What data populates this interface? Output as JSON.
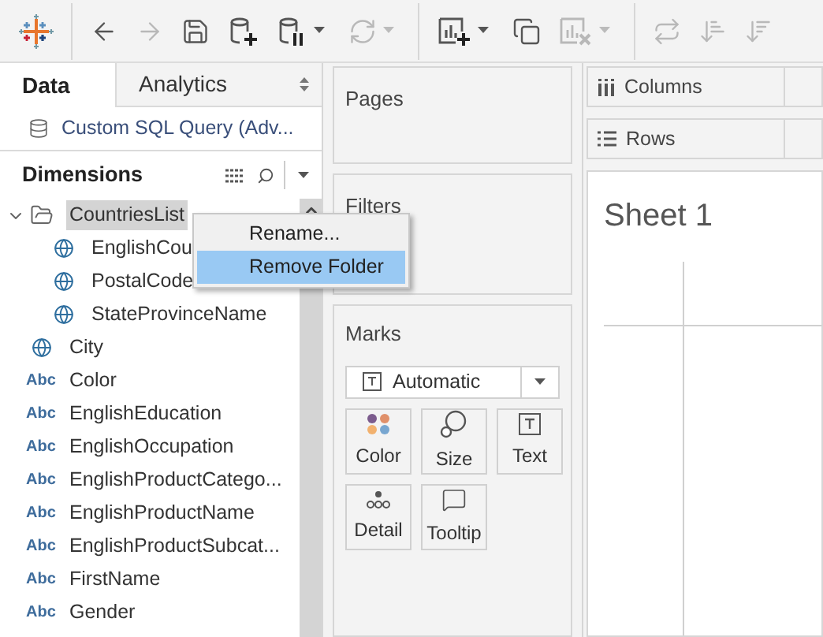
{
  "toolbar": [
    {
      "kind": "logo"
    },
    {
      "kind": "back",
      "disabled": false
    },
    {
      "kind": "forward",
      "disabled": true
    },
    {
      "kind": "save",
      "disabled": false
    },
    {
      "kind": "new-data-source",
      "disabled": false
    },
    {
      "kind": "pause",
      "disabled": false,
      "menu": true
    },
    {
      "kind": "refresh",
      "disabled": true,
      "menu": true
    },
    {
      "kind": "new-sheet",
      "disabled": false,
      "menu": true
    },
    {
      "kind": "duplicate",
      "disabled": false
    },
    {
      "kind": "clear",
      "disabled": true,
      "menu": true
    },
    {
      "kind": "swap",
      "disabled": true
    },
    {
      "kind": "sort-asc",
      "disabled": true
    },
    {
      "kind": "sort-desc",
      "disabled": true
    }
  ],
  "side_tabs": [
    {
      "label": "Data",
      "selected": true
    },
    {
      "label": "Analytics",
      "selected": false
    }
  ],
  "data_source": "Custom SQL Query (Adv...",
  "dimensions": {
    "title": "Dimensions",
    "items": [
      {
        "kind": "folder",
        "label": "CountriesList",
        "selected": true,
        "expanded": true,
        "children": [
          {
            "kind": "geo",
            "label": "EnglishCou"
          },
          {
            "kind": "geo",
            "label": "PostalCode"
          },
          {
            "kind": "geo",
            "label": "StateProvinceName"
          }
        ]
      },
      {
        "kind": "geo",
        "label": "City"
      },
      {
        "kind": "string",
        "type_label": "Abc",
        "label": "Color"
      },
      {
        "kind": "string",
        "type_label": "Abc",
        "label": "EnglishEducation"
      },
      {
        "kind": "string",
        "type_label": "Abc",
        "label": "EnglishOccupation"
      },
      {
        "kind": "string",
        "type_label": "Abc",
        "label": "EnglishProductCatego..."
      },
      {
        "kind": "string",
        "type_label": "Abc",
        "label": "EnglishProductName"
      },
      {
        "kind": "string",
        "type_label": "Abc",
        "label": "EnglishProductSubcat..."
      },
      {
        "kind": "string",
        "type_label": "Abc",
        "label": "FirstName"
      },
      {
        "kind": "string",
        "type_label": "Abc",
        "label": "Gender"
      }
    ]
  },
  "context_menu": [
    {
      "label": "Rename...",
      "selected": false
    },
    {
      "label": "Remove Folder",
      "selected": true
    }
  ],
  "cards": {
    "pages": "Pages",
    "filters": "Filters",
    "marks": {
      "title": "Marks",
      "mark_type": "Automatic",
      "buttons": [
        {
          "kind": "color",
          "label": "Color"
        },
        {
          "kind": "size",
          "label": "Size"
        },
        {
          "kind": "text",
          "label": "Text"
        },
        {
          "kind": "detail",
          "label": "Detail"
        },
        {
          "kind": "tooltip",
          "label": "Tooltip"
        }
      ]
    }
  },
  "shelves": [
    {
      "kind": "columns",
      "label": "Columns"
    },
    {
      "kind": "rows",
      "label": "Rows"
    }
  ],
  "sheet": {
    "title": "Sheet 1"
  }
}
